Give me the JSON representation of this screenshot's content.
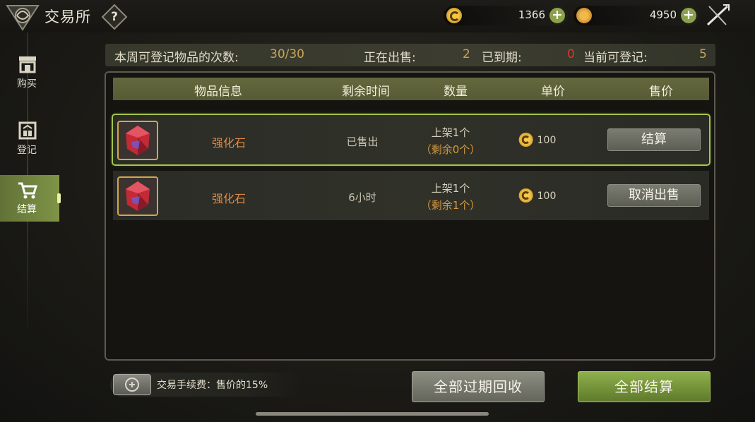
{
  "header": {
    "title": "交易所",
    "help_icon": "?",
    "currency_1": "1366",
    "currency_2": "4950"
  },
  "sidebar": {
    "items": [
      {
        "label": "购买",
        "icon": "shop-icon",
        "active": false
      },
      {
        "label": "登记",
        "icon": "register-icon",
        "active": false
      },
      {
        "label": "结算",
        "icon": "cart-icon",
        "active": true
      }
    ]
  },
  "stats": {
    "registrations_label": "本周可登记物品的次数:",
    "registrations_value": "30/30",
    "on_sale_label": "正在出售:",
    "on_sale_value": "2",
    "expired_label": "已到期:",
    "expired_value": "0",
    "available_label": "当前可登记:",
    "available_value": "5"
  },
  "table": {
    "headers": [
      "物品信息",
      "剩余时间",
      "数量",
      "单价",
      "售价"
    ],
    "rows": [
      {
        "name": "强化石",
        "time": "已售出",
        "qty_line1": "上架1个",
        "qty_line2": "（剩余0个）",
        "price": "100",
        "action": "结算"
      },
      {
        "name": "强化石",
        "time": "6小时",
        "qty_line1": "上架1个",
        "qty_line2": "（剩余1个）",
        "price": "100",
        "action": "取消出售"
      }
    ]
  },
  "footer": {
    "fee_text": "交易手续费：售价的15%",
    "reclaim_label": "全部过期回收",
    "settle_all_label": "全部结算"
  },
  "colors": {
    "accent_green": "#8fb04d",
    "item_name": "#de8a45",
    "stat_gold": "#c9a45a",
    "stat_red": "#d63a2a"
  }
}
